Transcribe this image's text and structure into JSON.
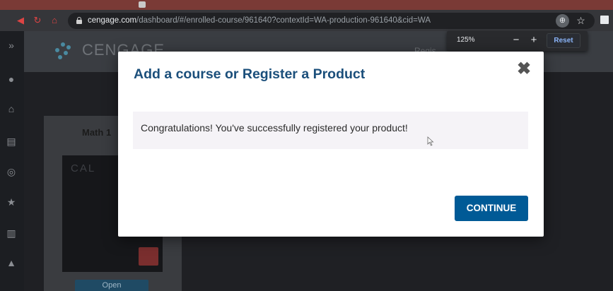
{
  "browser": {
    "url_host": "cengage.com",
    "url_path": "/dashboard/#/enrolled-course/961640?contextId=WA-production-961640&cid=WA",
    "zoom_popup": {
      "level": "125%",
      "minus": "−",
      "plus": "+",
      "reset_label": "Reset"
    }
  },
  "page": {
    "logo_text": "CENGAGE",
    "register_link": "Regis",
    "course_title": "Math 1",
    "book_text": "CAL",
    "open_button": "Open"
  },
  "modal": {
    "title": "Add a course or Register a Product",
    "message": "Congratulations! You've successfully registered your product!",
    "continue_label": "CONTINUE",
    "close_glyph": "✖"
  },
  "icons": {
    "back": "back-icon",
    "reload": "reload-icon",
    "home": "home-icon",
    "lock": "lock-icon",
    "zoom": "zoom-icon",
    "star": "star-icon",
    "menu": "menu-icon"
  },
  "colors": {
    "modal_title": "#1b4f7b",
    "continue_button": "#005a96",
    "message_bg": "#f5f3f7"
  }
}
